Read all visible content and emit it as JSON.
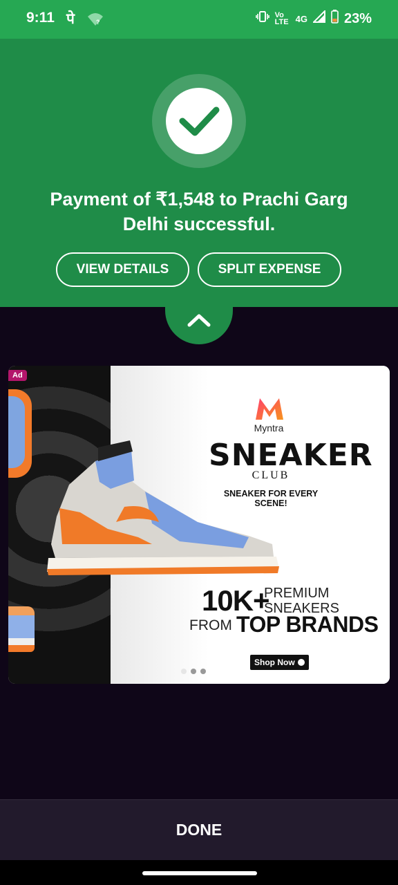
{
  "status_bar": {
    "time": "9:11",
    "app_glyph": "पे",
    "lte_label": "Vo LTE",
    "network": "4G",
    "battery": "23%"
  },
  "payment": {
    "message": "Payment of ₹1,548 to Prachi Garg Delhi successful.",
    "view_details_label": "VIEW DETAILS",
    "split_expense_label": "SPLIT EXPENSE"
  },
  "ad": {
    "badge": "Ad",
    "brand": "Myntra",
    "title": "SNEAKER",
    "subtitle": "CLUB",
    "tagline": "SNEAKER FOR EVERY SCENE!",
    "stat_value": "10K+",
    "stat_line1": "PREMIUM",
    "stat_line2": "SNEAKERS",
    "from_text": "FROM",
    "top_brands": "TOP BRANDS",
    "cta": "Shop Now"
  },
  "footer": {
    "done_label": "DONE"
  },
  "colors": {
    "status_green": "#26a853",
    "header_green": "#1f8c48",
    "check_green": "#1f8c48",
    "sheet_bg": "#0f0618",
    "done_bar_bg": "#221a2c"
  }
}
